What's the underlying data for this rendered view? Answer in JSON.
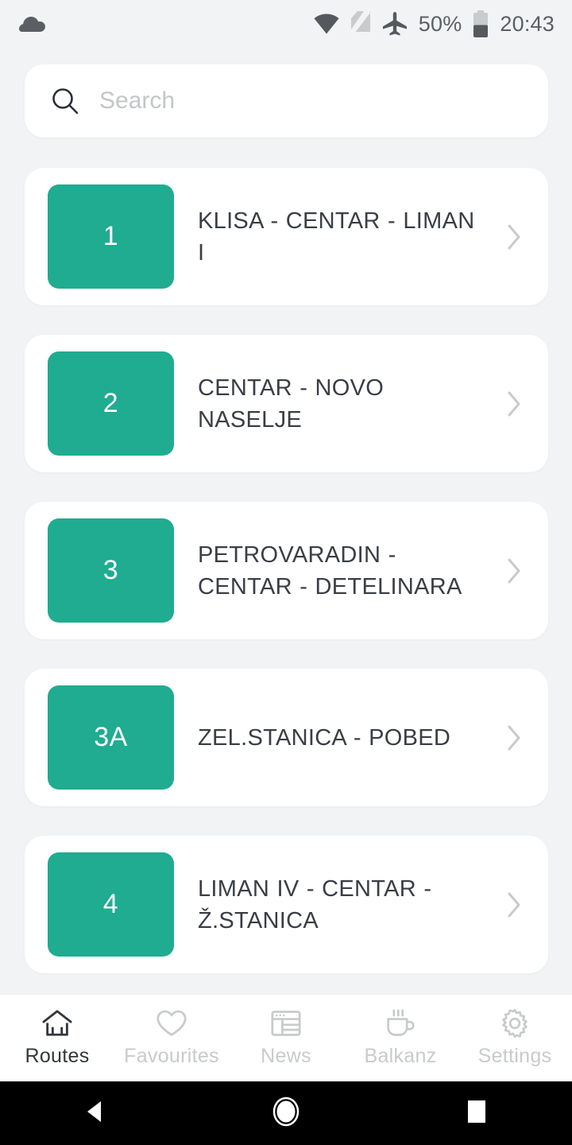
{
  "status_bar": {
    "cloud_icon": "cloud-icon",
    "wifi_icon": "wifi-icon",
    "sim_icon": "no-sim-card-icon",
    "airplane_icon": "airplane-mode-icon",
    "battery_percent": "50%",
    "battery_icon": "battery-half-icon",
    "time": "20:43"
  },
  "search": {
    "icon": "search-icon",
    "placeholder": "Search",
    "value": ""
  },
  "routes": [
    {
      "number": "1",
      "name": "KLISA - CENTAR - LIMAN I"
    },
    {
      "number": "2",
      "name": "CENTAR - NOVO NASELJE"
    },
    {
      "number": "3",
      "name": "PETROVARADIN - CENTAR - DETELINARA"
    },
    {
      "number": "3A",
      "name": "ZEL.STANICA - POBED"
    },
    {
      "number": "4",
      "name": "LIMAN IV - CENTAR - Ž.STANICA"
    }
  ],
  "bottom_nav": {
    "items": [
      {
        "label": "Routes",
        "icon": "home-icon",
        "active": true
      },
      {
        "label": "Favourites",
        "icon": "heart-icon",
        "active": false
      },
      {
        "label": "News",
        "icon": "news-icon",
        "active": false
      },
      {
        "label": "Balkanz",
        "icon": "coffee-cup-icon",
        "active": false
      },
      {
        "label": "Settings",
        "icon": "gear-icon",
        "active": false
      }
    ]
  },
  "android_nav": {
    "back": "back-triangle-icon",
    "home": "home-circle-icon",
    "recents": "recents-square-icon"
  },
  "colors": {
    "accent_green": "#1fac90",
    "page_background": "#f2f3f5",
    "card_background": "#ffffff",
    "text_primary": "#3a3e45",
    "text_muted": "#c8cacc"
  }
}
